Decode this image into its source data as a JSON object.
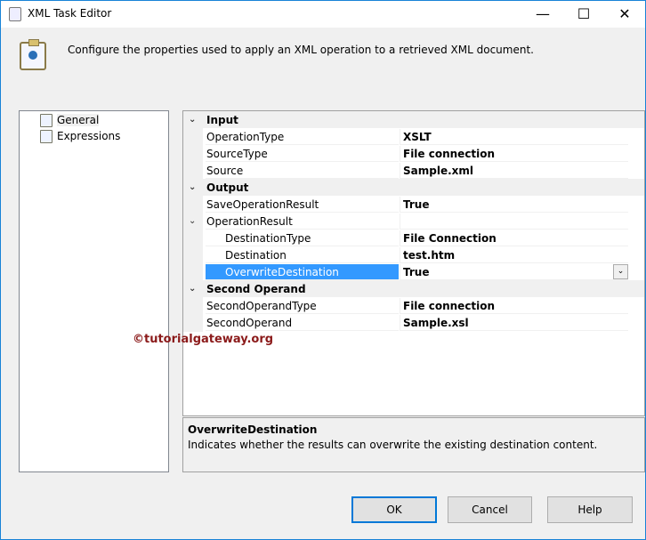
{
  "window": {
    "title": "XML Task Editor",
    "minimize": "—",
    "maximize": "☐",
    "close": "✕"
  },
  "description": "Configure the properties used to apply an XML operation to a retrieved XML document.",
  "tree": [
    {
      "label": "General"
    },
    {
      "label": "Expressions"
    }
  ],
  "grid": {
    "input": {
      "label": "Input",
      "rows": [
        {
          "name": "OperationType",
          "value": "XSLT"
        },
        {
          "name": "SourceType",
          "value": "File connection"
        },
        {
          "name": "Source",
          "value": "Sample.xml"
        }
      ]
    },
    "output": {
      "label": "Output",
      "save": {
        "name": "SaveOperationResult",
        "value": "True"
      },
      "opresult": {
        "name": "OperationResult",
        "value": ""
      },
      "rows": [
        {
          "name": "DestinationType",
          "value": "File Connection"
        },
        {
          "name": "Destination",
          "value": "test.htm"
        },
        {
          "name": "OverwriteDestination",
          "value": "True"
        }
      ]
    },
    "second": {
      "label": "Second Operand",
      "rows": [
        {
          "name": "SecondOperandType",
          "value": "File connection"
        },
        {
          "name": "SecondOperand",
          "value": "Sample.xsl"
        }
      ]
    }
  },
  "help": {
    "title": "OverwriteDestination",
    "text": "Indicates whether the results can overwrite the existing destination content."
  },
  "buttons": {
    "ok": "OK",
    "cancel": "Cancel",
    "help": "Help"
  },
  "watermark": "©tutorialgateway.org"
}
